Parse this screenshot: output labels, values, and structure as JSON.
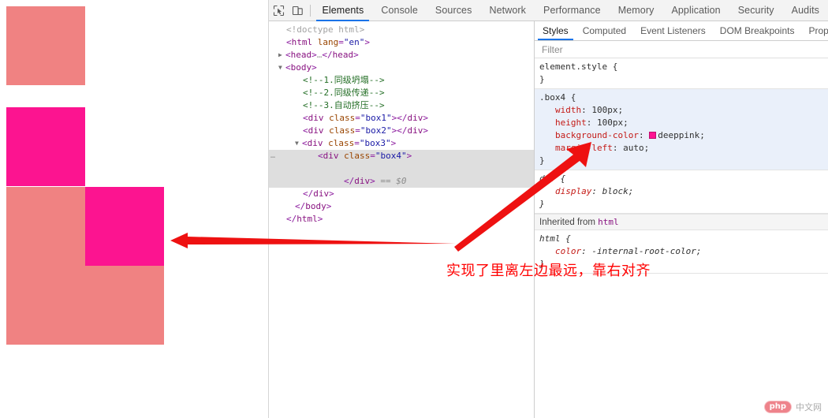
{
  "viewport": {
    "boxes": [
      {
        "name": "box1",
        "color": "#f08282",
        "label": ""
      },
      {
        "name": "box2",
        "color": "#fc1490",
        "label": ""
      },
      {
        "name": "box3",
        "color": "#f08282",
        "label": ""
      },
      {
        "name": "box4",
        "color": "#fc1490",
        "label": ""
      }
    ]
  },
  "toolbar": {
    "inspect_icon": "inspect-element-icon",
    "device_icon": "device-toolbar-icon",
    "tabs": [
      {
        "label": "Elements",
        "active": true
      },
      {
        "label": "Console",
        "active": false
      },
      {
        "label": "Sources",
        "active": false
      },
      {
        "label": "Network",
        "active": false
      },
      {
        "label": "Performance",
        "active": false
      },
      {
        "label": "Memory",
        "active": false
      },
      {
        "label": "Application",
        "active": false
      },
      {
        "label": "Security",
        "active": false
      },
      {
        "label": "Audits",
        "active": false
      }
    ]
  },
  "dom_tree": {
    "lines": [
      {
        "id": "l0",
        "text": "<!doctype html>"
      },
      {
        "id": "l1",
        "text": "<html lang=\"en\">"
      },
      {
        "id": "l2",
        "text": "<head>…</head>"
      },
      {
        "id": "l3",
        "text": "<body>"
      },
      {
        "id": "l4",
        "text": "<!--1.同级坍塌-->"
      },
      {
        "id": "l5",
        "text": "<!--2.同级传递-->"
      },
      {
        "id": "l6",
        "text": "<!--3.自动挤压-->"
      },
      {
        "id": "l7",
        "text": "<div class=\"box1\"></div>"
      },
      {
        "id": "l8",
        "text": "<div class=\"box2\"></div>"
      },
      {
        "id": "l9",
        "text": "<div class=\"box3\">"
      },
      {
        "id": "l10",
        "text": "<div class=\"box4\">"
      },
      {
        "id": "l11",
        "text": "</div> == $0"
      },
      {
        "id": "l12",
        "text": "</div>"
      },
      {
        "id": "l13",
        "text": "</body>"
      },
      {
        "id": "l14",
        "text": "</html>"
      }
    ],
    "tag_html": "html",
    "attr_lang_name": "lang",
    "attr_lang_value": "\"en\"",
    "tag_head": "head",
    "tag_body": "body",
    "tag_div": "div",
    "attr_class": "class",
    "class_box1": "\"box1\"",
    "class_box2": "\"box2\"",
    "class_box3": "\"box3\"",
    "class_box4": "\"box4\"",
    "doctype": "<!doctype html>",
    "comment1": "<!--1.同级坍塌-->",
    "comment2": "<!--2.同级传递-->",
    "comment3": "<!--3.自动挤压-->",
    "head_collapsed": "…",
    "selected_marker": "== $0",
    "gutter_ellipsis": "…"
  },
  "styles": {
    "tabs": [
      {
        "label": "Styles",
        "active": true
      },
      {
        "label": "Computed",
        "active": false
      },
      {
        "label": "Event Listeners",
        "active": false
      },
      {
        "label": "DOM Breakpoints",
        "active": false
      },
      {
        "label": "Prop",
        "active": false
      }
    ],
    "filter_placeholder": "Filter",
    "filter_value": "",
    "rules": [
      {
        "selector": "element.style",
        "declarations": [],
        "highlight": false,
        "ua": false
      },
      {
        "selector": ".box4",
        "declarations": [
          {
            "prop": "width",
            "value": "100px",
            "swatch": null
          },
          {
            "prop": "height",
            "value": "100px",
            "swatch": null
          },
          {
            "prop": "background-color",
            "value": "deeppink",
            "swatch": "#ff1493"
          },
          {
            "prop": "margin-left",
            "value": "auto",
            "swatch": null
          }
        ],
        "highlight": true,
        "ua": false
      },
      {
        "selector": "div",
        "declarations": [
          {
            "prop": "display",
            "value": "block",
            "swatch": null
          }
        ],
        "highlight": false,
        "ua": true
      }
    ],
    "inherited_label": "Inherited from",
    "inherited_source": "html",
    "inherited_rules": [
      {
        "selector": "html",
        "declarations": [
          {
            "prop": "color",
            "value": "-internal-root-color",
            "swatch": null
          }
        ],
        "highlight": false,
        "ua": true
      }
    ]
  },
  "annotation": {
    "text": "实现了里离左边最远，靠右对齐",
    "color": "#ff0000"
  },
  "watermark": {
    "badge": "php",
    "text": "中文网"
  }
}
